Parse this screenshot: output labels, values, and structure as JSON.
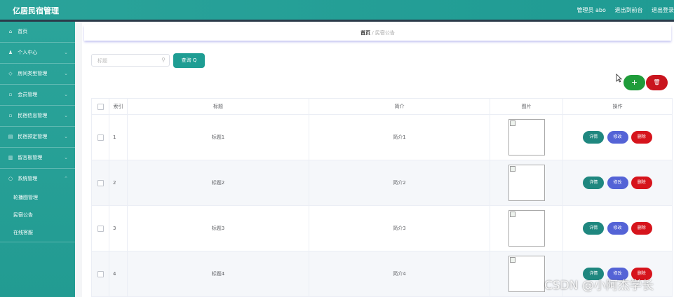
{
  "header": {
    "app_title": "亿居民宿管理",
    "user_label": "管理员 abo",
    "back_link": "退出到前台",
    "logout": "退出登录"
  },
  "sidebar": {
    "items": [
      {
        "label": "首页",
        "icon": "home-icon",
        "glyph": "⌂"
      },
      {
        "label": "个人中心",
        "icon": "user-icon",
        "glyph": "♟"
      },
      {
        "label": "房间类型管理",
        "icon": "room-type-icon",
        "glyph": "◇"
      },
      {
        "label": "会员管理",
        "icon": "member-icon",
        "glyph": "▫"
      },
      {
        "label": "民宿信息管理",
        "icon": "homestay-info-icon",
        "glyph": "▫"
      },
      {
        "label": "民宿预定管理",
        "icon": "booking-icon",
        "glyph": "▤"
      },
      {
        "label": "留言板管理",
        "icon": "message-board-icon",
        "glyph": "▥"
      },
      {
        "label": "系统管理",
        "icon": "system-icon",
        "glyph": "○"
      }
    ],
    "sub_items": [
      {
        "label": "轮播图管理"
      },
      {
        "label": "民宿公告"
      },
      {
        "label": "在线客服"
      }
    ]
  },
  "breadcrumb": {
    "home": "首页",
    "separator": "/",
    "current": "民宿公告"
  },
  "search": {
    "placeholder": "标题",
    "button_label": "查询 Q"
  },
  "actions": {
    "add_label": "+",
    "delete_label": "🗑"
  },
  "table": {
    "columns": [
      "索引",
      "标题",
      "简介",
      "图片",
      "操作"
    ],
    "rows": [
      {
        "index": "1",
        "title": "标题1",
        "intro": "简介1"
      },
      {
        "index": "2",
        "title": "标题2",
        "intro": "简介2"
      },
      {
        "index": "3",
        "title": "标题3",
        "intro": "简介3"
      },
      {
        "index": "4",
        "title": "标题4",
        "intro": "简介4"
      }
    ],
    "row_actions": {
      "detail": "详情",
      "edit": "修改",
      "delete": "删除"
    }
  },
  "watermark": "CSDN @小阿杰学长",
  "colors": {
    "primary": "#1e9d93",
    "add": "#1f9c3a",
    "danger": "#c9151e",
    "edit": "#5463d6",
    "detail": "#1f877f"
  }
}
